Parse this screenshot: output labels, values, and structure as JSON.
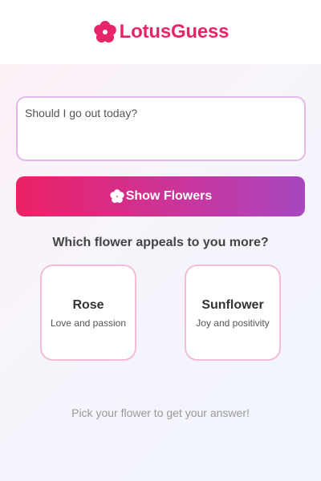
{
  "app": {
    "name": "LotusGuess",
    "logo_icon": "flower-icon",
    "brand_color": "#e8246b"
  },
  "question_input": {
    "value": "Should I go out today?",
    "placeholder": ""
  },
  "show_button": {
    "label": "Show Flowers",
    "icon": "flower-icon"
  },
  "prompt": "Which flower appeals to you more?",
  "choices": [
    {
      "name": "Rose",
      "description": "Love and passion"
    },
    {
      "name": "Sunflower",
      "description": "Joy and positivity"
    }
  ],
  "hint": "Pick your flower to get your answer!"
}
